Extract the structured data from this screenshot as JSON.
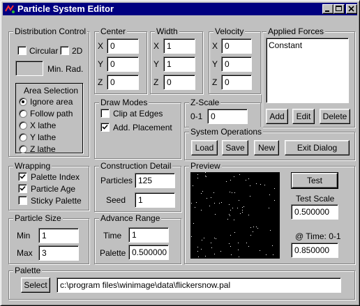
{
  "window": {
    "title": "Particle System Editor"
  },
  "distribution": {
    "label": "Distribution Control",
    "circular_label": "Circular",
    "circular_checked": false,
    "twod_label": "2D",
    "twod_checked": false,
    "min_rad_label": "Min. Rad.",
    "min_rad_value": "",
    "area_selection": {
      "label": "Area Selection",
      "options": [
        "Ignore area",
        "Follow path",
        "X lathe",
        "Y lathe",
        "Z lathe"
      ],
      "selected": "Ignore area"
    }
  },
  "center": {
    "label": "Center",
    "x": "0",
    "y": "0",
    "z": "0"
  },
  "width": {
    "label": "Width",
    "x": "1",
    "y": "1",
    "z": "0"
  },
  "velocity": {
    "label": "Velocity",
    "x": "0",
    "y": "0",
    "z": "0"
  },
  "axis_labels": {
    "x": "X",
    "y": "Y",
    "z": "Z"
  },
  "applied_forces": {
    "label": "Applied Forces",
    "items": [
      "Constant"
    ],
    "add_label": "Add",
    "edit_label": "Edit",
    "delete_label": "Delete"
  },
  "draw_modes": {
    "label": "Draw Modes",
    "clip_label": "Clip at Edges",
    "clip_checked": false,
    "placement_label": "Add. Placement",
    "placement_checked": true
  },
  "zscale": {
    "label": "Z-Scale",
    "range_label": "0-1",
    "value": "0"
  },
  "system_ops": {
    "label": "System Operations",
    "load_label": "Load",
    "save_label": "Save",
    "new_label": "New",
    "exit_label": "Exit Dialog"
  },
  "wrapping": {
    "label": "Wrapping",
    "palette_index_label": "Palette Index",
    "palette_index_checked": true,
    "particle_age_label": "Particle Age",
    "particle_age_checked": true,
    "sticky_palette_label": "Sticky Palette",
    "sticky_palette_checked": false
  },
  "construction": {
    "label": "Construction Detail",
    "particles_label": "Particles",
    "particles_value": "125",
    "seed_label": "Seed",
    "seed_value": "1"
  },
  "preview": {
    "label": "Preview",
    "test_label": "Test",
    "test_scale_label": "Test Scale",
    "test_scale_value": "0.500000",
    "time_label": "@ Time: 0-1",
    "time_value": "0.850000",
    "background_color": "#000000",
    "particle_color": "#ffffff"
  },
  "particle_size": {
    "label": "Particle Size",
    "min_label": "Min",
    "min_value": "1",
    "max_label": "Max",
    "max_value": "3"
  },
  "advance_range": {
    "label": "Advance Range",
    "time_label": "Time",
    "time_value": "1",
    "palette_label": "Palette",
    "palette_value": "0.500000"
  },
  "palette": {
    "label": "Palette",
    "select_label": "Select",
    "path": "c:\\program files\\winimage\\data\\flickersnow.pal"
  }
}
